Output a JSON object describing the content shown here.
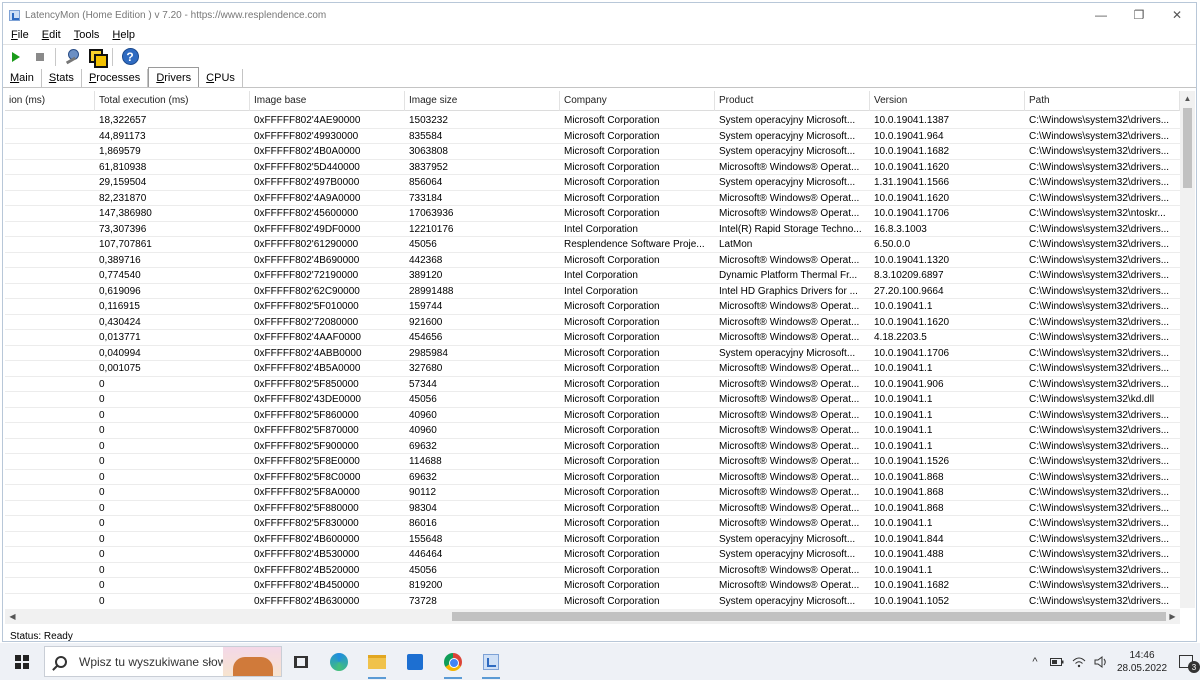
{
  "window": {
    "title": "LatencyMon  (Home Edition )  v 7.20 - https://www.resplendence.com",
    "minimize": "—",
    "maximize": "❐",
    "close": "✕"
  },
  "menu": [
    {
      "key": "F",
      "rest": "ile"
    },
    {
      "key": "E",
      "rest": "dit"
    },
    {
      "key": "T",
      "rest": "ools"
    },
    {
      "key": "H",
      "rest": "elp"
    }
  ],
  "toolbar": {
    "help_glyph": "?"
  },
  "tabs": [
    {
      "key": "M",
      "rest": "ain",
      "active": false
    },
    {
      "key": "S",
      "rest": "tats",
      "active": false
    },
    {
      "key": "P",
      "rest": "rocesses",
      "active": false
    },
    {
      "key": "D",
      "rest": "rivers",
      "active": true
    },
    {
      "key": "C",
      "rest": "PUs",
      "active": false
    }
  ],
  "table": {
    "columns": [
      "ion (ms)",
      "Total execution (ms)",
      "Image base",
      "Image size",
      "Company",
      "Product",
      "Version",
      "Path"
    ],
    "rows": [
      [
        "",
        "18,322657",
        "0xFFFFF802'4AE90000",
        "1503232",
        "Microsoft Corporation",
        "System operacyjny Microsoft...",
        "10.0.19041.1387",
        "C:\\Windows\\system32\\drivers..."
      ],
      [
        "",
        "44,891173",
        "0xFFFFF802'49930000",
        "835584",
        "Microsoft Corporation",
        "System operacyjny Microsoft...",
        "10.0.19041.964",
        "C:\\Windows\\system32\\drivers..."
      ],
      [
        "",
        "1,869579",
        "0xFFFFF802'4B0A0000",
        "3063808",
        "Microsoft Corporation",
        "System operacyjny Microsoft...",
        "10.0.19041.1682",
        "C:\\Windows\\system32\\drivers..."
      ],
      [
        "",
        "61,810938",
        "0xFFFFF802'5D440000",
        "3837952",
        "Microsoft Corporation",
        "Microsoft® Windows® Operat...",
        "10.0.19041.1620",
        "C:\\Windows\\system32\\drivers..."
      ],
      [
        "",
        "29,159504",
        "0xFFFFF802'497B0000",
        "856064",
        "Microsoft Corporation",
        "System operacyjny Microsoft...",
        "1.31.19041.1566",
        "C:\\Windows\\system32\\drivers..."
      ],
      [
        "",
        "82,231870",
        "0xFFFFF802'4A9A0000",
        "733184",
        "Microsoft Corporation",
        "Microsoft® Windows® Operat...",
        "10.0.19041.1620",
        "C:\\Windows\\system32\\drivers..."
      ],
      [
        "",
        "147,386980",
        "0xFFFFF802'45600000",
        "17063936",
        "Microsoft Corporation",
        "Microsoft® Windows® Operat...",
        "10.0.19041.1706",
        "C:\\Windows\\system32\\ntoskr..."
      ],
      [
        "",
        "73,307396",
        "0xFFFFF802'49DF0000",
        "12210176",
        "Intel Corporation",
        "Intel(R) Rapid Storage Techno...",
        "16.8.3.1003",
        "C:\\Windows\\system32\\drivers..."
      ],
      [
        "",
        "107,707861",
        "0xFFFFF802'61290000",
        "45056",
        "Resplendence Software Proje...",
        "LatMon",
        "6.50.0.0",
        "C:\\Windows\\system32\\drivers..."
      ],
      [
        "",
        "0,389716",
        "0xFFFFF802'4B690000",
        "442368",
        "Microsoft Corporation",
        "Microsoft® Windows® Operat...",
        "10.0.19041.1320",
        "C:\\Windows\\system32\\drivers..."
      ],
      [
        "",
        "0,774540",
        "0xFFFFF802'72190000",
        "389120",
        "Intel Corporation",
        "Dynamic Platform Thermal Fr...",
        "8.3.10209.6897",
        "C:\\Windows\\system32\\drivers..."
      ],
      [
        "",
        "0,619096",
        "0xFFFFF802'62C90000",
        "28991488",
        "Intel Corporation",
        "Intel HD Graphics Drivers for ...",
        "27.20.100.9664",
        "C:\\Windows\\system32\\drivers..."
      ],
      [
        "",
        "0,116915",
        "0xFFFFF802'5F010000",
        "159744",
        "Microsoft Corporation",
        "Microsoft® Windows® Operat...",
        "10.0.19041.1",
        "C:\\Windows\\system32\\drivers..."
      ],
      [
        "",
        "0,430424",
        "0xFFFFF802'72080000",
        "921600",
        "Microsoft Corporation",
        "Microsoft® Windows® Operat...",
        "10.0.19041.1620",
        "C:\\Windows\\system32\\drivers..."
      ],
      [
        "",
        "0,013771",
        "0xFFFFF802'4AAF0000",
        "454656",
        "Microsoft Corporation",
        "Microsoft® Windows® Operat...",
        "4.18.2203.5",
        "C:\\Windows\\system32\\drivers..."
      ],
      [
        "",
        "0,040994",
        "0xFFFFF802'4ABB0000",
        "2985984",
        "Microsoft Corporation",
        "System operacyjny Microsoft...",
        "10.0.19041.1706",
        "C:\\Windows\\system32\\drivers..."
      ],
      [
        "",
        "0,001075",
        "0xFFFFF802'4B5A0000",
        "327680",
        "Microsoft Corporation",
        "Microsoft® Windows® Operat...",
        "10.0.19041.1",
        "C:\\Windows\\system32\\drivers..."
      ],
      [
        "",
        "0",
        "0xFFFFF802'5F850000",
        "57344",
        "Microsoft Corporation",
        "Microsoft® Windows® Operat...",
        "10.0.19041.906",
        "C:\\Windows\\system32\\drivers..."
      ],
      [
        "",
        "0",
        "0xFFFFF802'43DE0000",
        "45056",
        "Microsoft Corporation",
        "Microsoft® Windows® Operat...",
        "10.0.19041.1",
        "C:\\Windows\\system32\\kd.dll"
      ],
      [
        "",
        "0",
        "0xFFFFF802'5F860000",
        "40960",
        "Microsoft Corporation",
        "Microsoft® Windows® Operat...",
        "10.0.19041.1",
        "C:\\Windows\\system32\\drivers..."
      ],
      [
        "",
        "0",
        "0xFFFFF802'5F870000",
        "40960",
        "Microsoft Corporation",
        "Microsoft® Windows® Operat...",
        "10.0.19041.1",
        "C:\\Windows\\system32\\drivers..."
      ],
      [
        "",
        "0",
        "0xFFFFF802'5F900000",
        "69632",
        "Microsoft Corporation",
        "Microsoft® Windows® Operat...",
        "10.0.19041.1",
        "C:\\Windows\\system32\\drivers..."
      ],
      [
        "",
        "0",
        "0xFFFFF802'5F8E0000",
        "114688",
        "Microsoft Corporation",
        "Microsoft® Windows® Operat...",
        "10.0.19041.1526",
        "C:\\Windows\\system32\\drivers..."
      ],
      [
        "",
        "0",
        "0xFFFFF802'5F8C0000",
        "69632",
        "Microsoft Corporation",
        "Microsoft® Windows® Operat...",
        "10.0.19041.868",
        "C:\\Windows\\system32\\drivers..."
      ],
      [
        "",
        "0",
        "0xFFFFF802'5F8A0000",
        "90112",
        "Microsoft Corporation",
        "Microsoft® Windows® Operat...",
        "10.0.19041.868",
        "C:\\Windows\\system32\\drivers..."
      ],
      [
        "",
        "0",
        "0xFFFFF802'5F880000",
        "98304",
        "Microsoft Corporation",
        "Microsoft® Windows® Operat...",
        "10.0.19041.868",
        "C:\\Windows\\system32\\drivers..."
      ],
      [
        "",
        "0",
        "0xFFFFF802'5F830000",
        "86016",
        "Microsoft Corporation",
        "Microsoft® Windows® Operat...",
        "10.0.19041.1",
        "C:\\Windows\\system32\\drivers..."
      ],
      [
        "",
        "0",
        "0xFFFFF802'4B600000",
        "155648",
        "Microsoft Corporation",
        "System operacyjny Microsoft...",
        "10.0.19041.844",
        "C:\\Windows\\system32\\drivers..."
      ],
      [
        "",
        "0",
        "0xFFFFF802'4B530000",
        "446464",
        "Microsoft Corporation",
        "System operacyjny Microsoft...",
        "10.0.19041.488",
        "C:\\Windows\\system32\\drivers..."
      ],
      [
        "",
        "0",
        "0xFFFFF802'4B520000",
        "45056",
        "Microsoft Corporation",
        "Microsoft® Windows® Operat...",
        "10.0.19041.1",
        "C:\\Windows\\system32\\drivers..."
      ],
      [
        "",
        "0",
        "0xFFFFF802'4B450000",
        "819200",
        "Microsoft Corporation",
        "Microsoft® Windows® Operat...",
        "10.0.19041.1682",
        "C:\\Windows\\system32\\drivers..."
      ],
      [
        "",
        "0",
        "0xFFFFF802'4B630000",
        "73728",
        "Microsoft Corporation",
        "System operacyjny Microsoft...",
        "10.0.19041.1052",
        "C:\\Windows\\system32\\drivers..."
      ]
    ]
  },
  "scroll": {
    "up": "▲",
    "down": "▼",
    "left": "◀",
    "right": "▶"
  },
  "status": {
    "text": "Status: Ready"
  },
  "taskbar": {
    "search_placeholder": "Wpisz tu wyszukiwane słowa",
    "tray_chevron": "^",
    "time": "14:46",
    "date": "28.05.2022",
    "notification_count": "3",
    "icons": [
      "windows-start-icon",
      "search-icon",
      "task-view-icon",
      "edge-icon",
      "file-explorer-icon",
      "store-icon",
      "chrome-icon",
      "latencymon-icon"
    ]
  }
}
